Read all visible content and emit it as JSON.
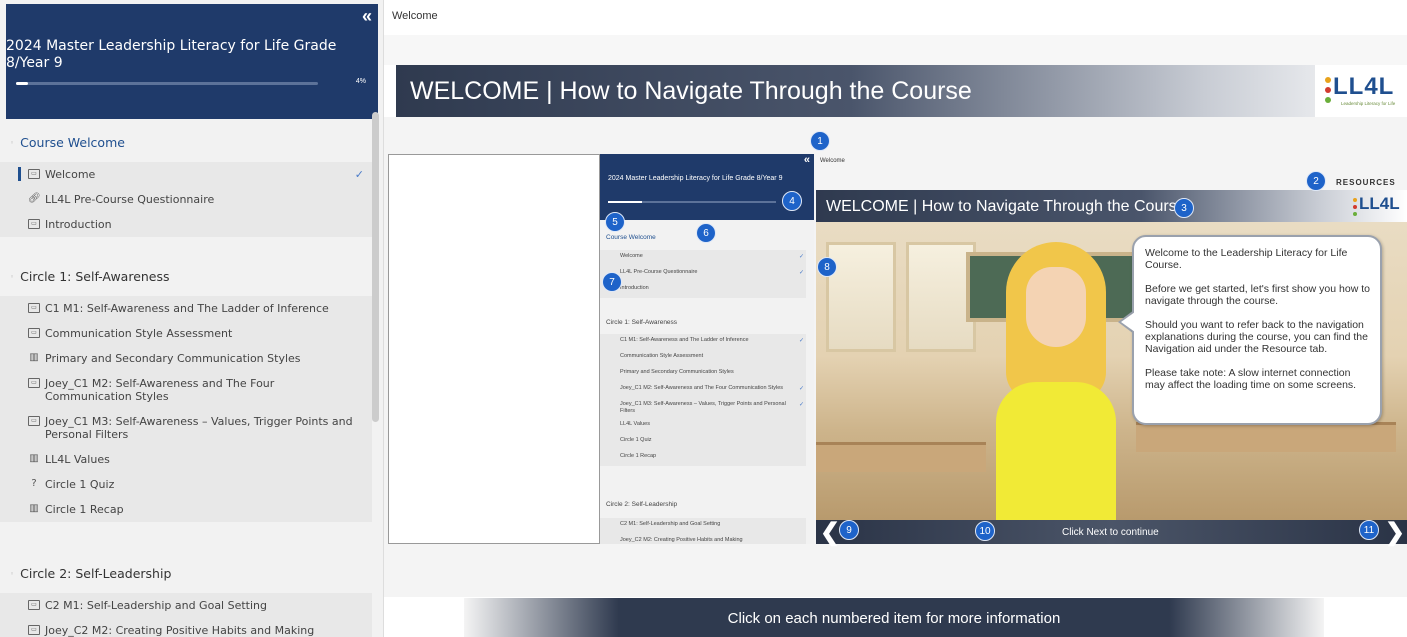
{
  "sidebar": {
    "title": "2024 Master Leadership Literacy for Life Grade 8/Year 9",
    "progress_pct": 4,
    "progress_label": "4%",
    "collapse_glyph": "«",
    "sections": [
      {
        "title": "Course Welcome",
        "items": [
          {
            "label": "Welcome",
            "icon": "page-icon",
            "current": true,
            "done": true
          },
          {
            "label": "LL4L Pre-Course Questionnaire",
            "icon": "link-icon"
          },
          {
            "label": "Introduction",
            "icon": "page-icon"
          }
        ]
      },
      {
        "title": "Circle 1: Self-Awareness",
        "items": [
          {
            "label": "C1 M1: Self-Awareness and The Ladder of Inference",
            "icon": "page-icon"
          },
          {
            "label": "Communication Style Assessment",
            "icon": "page-icon"
          },
          {
            "label": "Primary and Secondary Communication Styles",
            "icon": "chart-icon"
          },
          {
            "label": "Joey_C1 M2: Self-Awareness and The Four Communication Styles",
            "icon": "page-icon"
          },
          {
            "label": "Joey_C1 M3: Self-Awareness – Values, Trigger Points and Personal Filters",
            "icon": "page-icon"
          },
          {
            "label": "LL4L Values",
            "icon": "chart-icon"
          },
          {
            "label": "Circle 1 Quiz",
            "icon": "quiz-icon"
          },
          {
            "label": "Circle 1 Recap",
            "icon": "chart-icon"
          }
        ]
      },
      {
        "title": "Circle 2: Self-Leadership",
        "items": [
          {
            "label": "C2 M1: Self-Leadership and Goal Setting",
            "icon": "page-icon"
          },
          {
            "label": "Joey_C2 M2: Creating Positive Habits and Making",
            "icon": "page-icon"
          }
        ]
      }
    ]
  },
  "main": {
    "breadcrumb": "Welcome",
    "banner_title": "WELCOME | How to Navigate Through the Course",
    "logo_text": "LL4L",
    "logo_tagline": "Leadership Literacy for Life",
    "bottom_text": "Click on each numbered item for more information"
  },
  "illustration": {
    "breadcrumb": "Welcome",
    "resources_label": "RESOURCES",
    "banner_title": "WELCOME | How to Navigate Through the Course",
    "logo_text": "LL4L",
    "bubble": [
      "Welcome to the Leadership Literacy for Life Course.",
      "Before we get started, let's first show you how to navigate through the course.",
      "Should you want to refer back to the navigation explanations during the course, you can find the Navigation aid under the Resource tab.",
      "Please take note: A slow internet connection may affect the loading time on some screens."
    ],
    "next_text": "Click Next to continue",
    "prev_glyph": "❮",
    "next_glyph": "❯",
    "mini_sidebar": {
      "title": "2024 Master Leadership Literacy for Life Grade 8/Year 9",
      "section1": "Course Welcome",
      "section1_items": [
        "Welcome",
        "LL4L Pre-Course Questionnaire",
        "Introduction"
      ],
      "section2": "Circle 1: Self-Awareness",
      "section2_items": [
        "C1 M1: Self-Awareness and The Ladder of Inference",
        "Communication Style Assessment",
        "Primary and Secondary Communication Styles",
        "Joey_C1 M2: Self-Awareness and The Four Communication Styles",
        "Joey_C1 M3: Self-Awareness – Values, Trigger Points and Personal Filters",
        "LL4L Values",
        "Circle 1 Quiz",
        "Circle 1 Recap"
      ],
      "section3": "Circle 2: Self-Leadership",
      "section3_items": [
        "C2 M1: Self-Leadership and Goal Setting",
        "Joey_C2 M2: Creating Positive Habits and Making"
      ]
    },
    "badges": [
      "1",
      "2",
      "3",
      "4",
      "5",
      "6",
      "7",
      "8",
      "9",
      "10",
      "11"
    ]
  },
  "colors": {
    "sidebar_header": "#1f3a6a",
    "accent": "#1f4f8f",
    "badge": "#1e63c9",
    "shirt": "#f1ea36"
  }
}
